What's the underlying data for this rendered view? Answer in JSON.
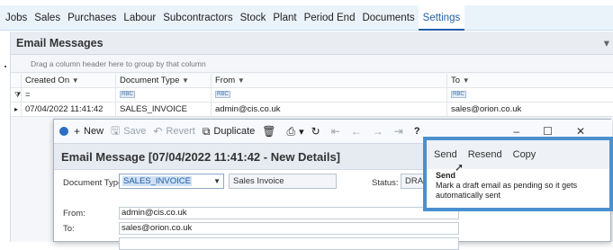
{
  "menubar": {
    "items": [
      "Jobs",
      "Sales",
      "Purchases",
      "Labour",
      "Subcontractors",
      "Stock",
      "Plant",
      "Period End",
      "Documents",
      "Settings"
    ],
    "active": "Settings"
  },
  "panel": {
    "title": "Email Messages",
    "group_hint": "Drag a column header here to group by that column"
  },
  "grid": {
    "columns": [
      "Created On",
      "Document Type",
      "From",
      "To"
    ],
    "filter_row": {
      "created_on": "=",
      "rbc": "RBC"
    },
    "rows": [
      {
        "created_on": "07/04/2022 11:41:42",
        "document_type": "SALES_INVOICE",
        "from": "admin@cis.co.uk",
        "to": "sales@orion.co.uk"
      }
    ]
  },
  "dialog": {
    "toolbar": {
      "new": "New",
      "save": "Save",
      "revert": "Revert",
      "duplicate": "Duplicate",
      "help": "?"
    },
    "title": "Email Message [07/04/2022 11:41:42 - New Details]",
    "document_type_label": "Document Type:",
    "document_type_value": "SALES_INVOICE",
    "document_type_desc": "Sales Invoice",
    "status_label": "Status:",
    "status_value": "DRAF",
    "from_label": "From:",
    "from_value": "admin@cis.co.uk",
    "to_label": "To:",
    "to_value": "sales@orion.co.uk"
  },
  "popup": {
    "buttons": [
      "Send",
      "Resend",
      "Copy"
    ],
    "tooltip_title": "Send",
    "tooltip_text": "Mark a draft email as pending so it gets automatically sent"
  },
  "colors": {
    "accent": "#1e5ea8",
    "highlight_border": "#4a90cf"
  }
}
